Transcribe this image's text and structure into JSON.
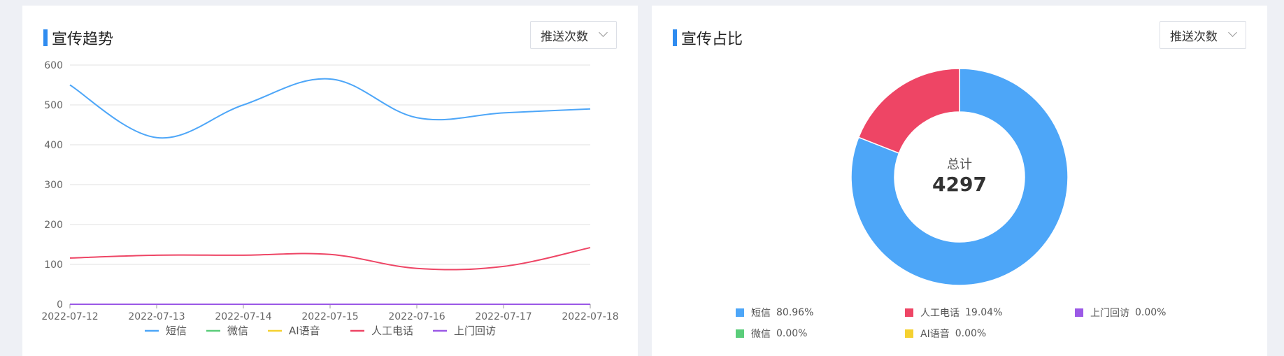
{
  "left_card": {
    "title": "宣传趋势",
    "dropdown_value": "推送次数"
  },
  "right_card": {
    "title": "宣传占比",
    "dropdown_value": "推送次数",
    "center_label": "总计",
    "center_total": "4297"
  },
  "colors": {
    "短信": "#4da6f8",
    "微信": "#5acd7a",
    "AI语音": "#f5d130",
    "人工电话": "#ee4565",
    "上门回访": "#9b59e6"
  },
  "chart_data": [
    {
      "type": "line",
      "x": [
        "2022-07-12",
        "2022-07-13",
        "2022-07-14",
        "2022-07-15",
        "2022-07-16",
        "2022-07-17",
        "2022-07-18"
      ],
      "ylim": [
        0,
        600
      ],
      "yticks": [
        0,
        100,
        200,
        300,
        400,
        500,
        600
      ],
      "grid": true,
      "legend_position": "bottom",
      "series": [
        {
          "name": "短信",
          "values": [
            550,
            418,
            500,
            565,
            468,
            480,
            490
          ]
        },
        {
          "name": "微信",
          "values": [
            0,
            0,
            0,
            0,
            0,
            0,
            0
          ]
        },
        {
          "name": "AI语音",
          "values": [
            0,
            0,
            0,
            0,
            0,
            0,
            0
          ]
        },
        {
          "name": "人工电话",
          "values": [
            116,
            123,
            123,
            125,
            90,
            95,
            142
          ]
        },
        {
          "name": "上门回访",
          "values": [
            0,
            0,
            0,
            0,
            0,
            0,
            0
          ]
        }
      ]
    },
    {
      "type": "pie",
      "donut": true,
      "total": 4297,
      "slices": [
        {
          "name": "短信",
          "value": 80.96,
          "label": "80.96%"
        },
        {
          "name": "人工电话",
          "value": 19.04,
          "label": "19.04%"
        },
        {
          "name": "上门回访",
          "value": 0,
          "label": "0.00%"
        },
        {
          "name": "微信",
          "value": 0,
          "label": "0.00%"
        },
        {
          "name": "AI语音",
          "value": 0,
          "label": "0.00%"
        }
      ],
      "legend_position": "bottom"
    }
  ]
}
